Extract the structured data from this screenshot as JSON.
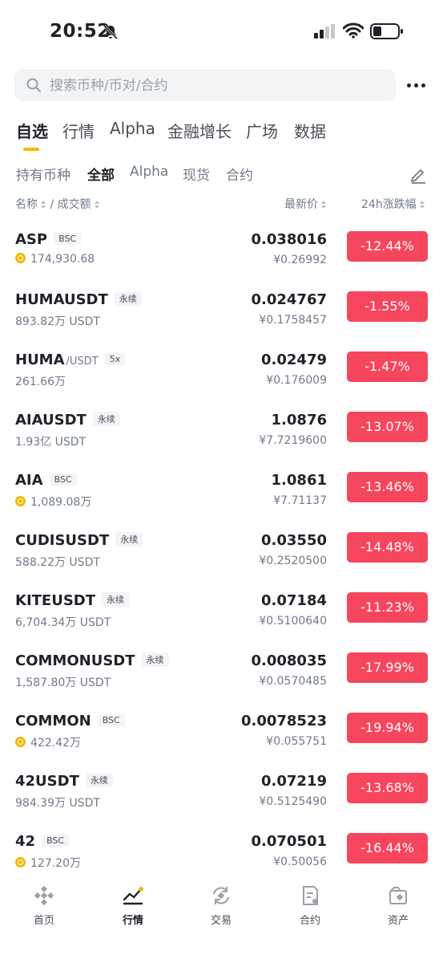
{
  "status_bar": {
    "time": "20:52"
  },
  "search": {
    "placeholder": "搜索币种/币对/合约"
  },
  "main_tabs": [
    "自选",
    "行情",
    "Alpha",
    "金融增长",
    "广场",
    "数据"
  ],
  "sub_tabs": [
    "持有币种",
    "全部",
    "Alpha",
    "现货",
    "合约"
  ],
  "columns": {
    "name": "名称",
    "separator": "/",
    "volume": "成交额",
    "price": "最新价",
    "change": "24h涨跌幅"
  },
  "rows": [
    {
      "symbol": "ASP",
      "quote": "",
      "tag": "BSC",
      "alpha": true,
      "volume": "174,930.68",
      "price": "0.038016",
      "cny": "¥0.26992",
      "change": "-12.44%"
    },
    {
      "symbol": "HUMAUSDT",
      "quote": "",
      "tag": "永续",
      "alpha": false,
      "volume": "893.82万 USDT",
      "price": "0.024767",
      "cny": "¥0.1758457",
      "change": "-1.55%"
    },
    {
      "symbol": "HUMA",
      "quote": "/USDT",
      "tag": "5x",
      "alpha": false,
      "volume": "261.66万",
      "price": "0.02479",
      "cny": "¥0.176009",
      "change": "-1.47%"
    },
    {
      "symbol": "AIAUSDT",
      "quote": "",
      "tag": "永续",
      "alpha": false,
      "volume": "1.93亿 USDT",
      "price": "1.0876",
      "cny": "¥7.7219600",
      "change": "-13.07%"
    },
    {
      "symbol": "AIA",
      "quote": "",
      "tag": "BSC",
      "alpha": true,
      "volume": "1,089.08万",
      "price": "1.0861",
      "cny": "¥7.71137",
      "change": "-13.46%"
    },
    {
      "symbol": "CUDISUSDT",
      "quote": "",
      "tag": "永续",
      "alpha": false,
      "volume": "588.22万 USDT",
      "price": "0.03550",
      "cny": "¥0.2520500",
      "change": "-14.48%"
    },
    {
      "symbol": "KITEUSDT",
      "quote": "",
      "tag": "永续",
      "alpha": false,
      "volume": "6,704.34万 USDT",
      "price": "0.07184",
      "cny": "¥0.5100640",
      "change": "-11.23%"
    },
    {
      "symbol": "COMMONUSDT",
      "quote": "",
      "tag": "永续",
      "alpha": false,
      "volume": "1,587.80万 USDT",
      "price": "0.008035",
      "cny": "¥0.0570485",
      "change": "-17.99%"
    },
    {
      "symbol": "COMMON",
      "quote": "",
      "tag": "BSC",
      "alpha": true,
      "volume": "422.42万",
      "price": "0.0078523",
      "cny": "¥0.055751",
      "change": "-19.94%"
    },
    {
      "symbol": "42USDT",
      "quote": "",
      "tag": "永续",
      "alpha": false,
      "volume": "984.39万 USDT",
      "price": "0.07219",
      "cny": "¥0.5125490",
      "change": "-13.68%"
    },
    {
      "symbol": "42",
      "quote": "",
      "tag": "BSC",
      "alpha": true,
      "volume": "127.20万",
      "price": "0.070501",
      "cny": "¥0.50056",
      "change": "-16.44%"
    }
  ],
  "bottom_nav": [
    {
      "label": "首页",
      "icon": "home-icon"
    },
    {
      "label": "行情",
      "icon": "markets-icon"
    },
    {
      "label": "交易",
      "icon": "trade-icon"
    },
    {
      "label": "合约",
      "icon": "futures-icon"
    },
    {
      "label": "资产",
      "icon": "wallet-icon"
    }
  ],
  "colors": {
    "accent": "#f0b90b",
    "negative": "#f6465d",
    "text": "#1e2329",
    "muted": "#707a8a"
  }
}
